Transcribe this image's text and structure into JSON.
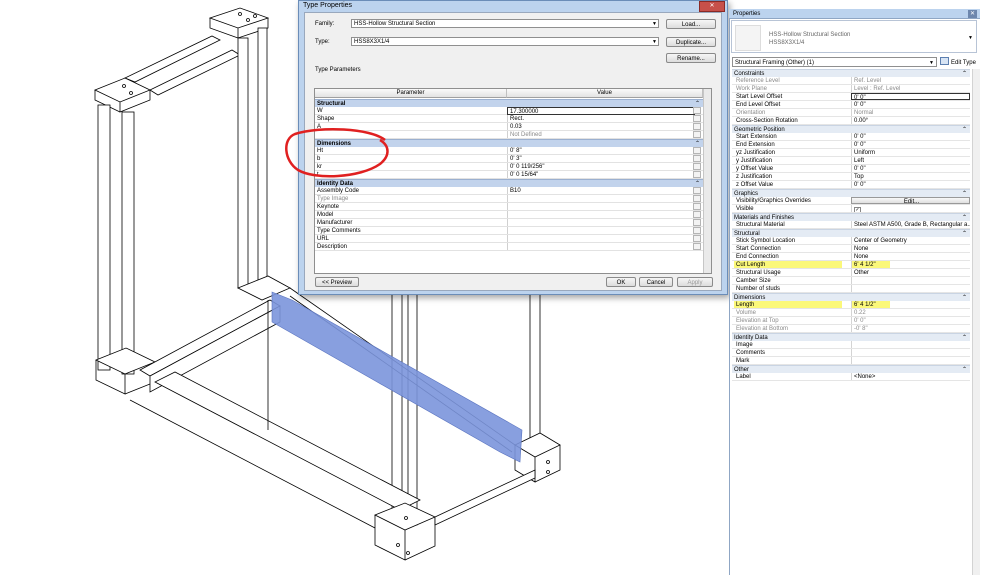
{
  "dialog": {
    "title": "Type Properties",
    "family_label": "Family:",
    "family_value": "HSS-Hollow Structural Section",
    "type_label": "Type:",
    "type_value": "HSS8X3X1/4",
    "load_btn": "Load...",
    "duplicate_btn": "Duplicate...",
    "rename_btn": "Rename...",
    "type_params_label": "Type Parameters",
    "col_parameter": "Parameter",
    "col_value": "Value",
    "groups": [
      {
        "name": "Structural",
        "rows": [
          {
            "p": "W",
            "v": "17.300000"
          },
          {
            "p": "Shape",
            "v": "Rect."
          },
          {
            "p": "A",
            "v": "0.03"
          },
          {
            "p": "",
            "v": "Not Defined"
          }
        ]
      },
      {
        "name": "Dimensions",
        "rows": [
          {
            "p": "Ht",
            "v": "0'  8\""
          },
          {
            "p": "b",
            "v": "0'  3\""
          },
          {
            "p": "kr",
            "v": "0'  0 119/256\""
          },
          {
            "p": "t",
            "v": "0'  0 15/64\""
          }
        ]
      },
      {
        "name": "Identity Data",
        "rows": [
          {
            "p": "Assembly Code",
            "v": "B10"
          },
          {
            "p": "Type Image",
            "v": ""
          },
          {
            "p": "Keynote",
            "v": ""
          },
          {
            "p": "Model",
            "v": ""
          },
          {
            "p": "Manufacturer",
            "v": ""
          },
          {
            "p": "Type Comments",
            "v": ""
          },
          {
            "p": "URL",
            "v": ""
          },
          {
            "p": "Description",
            "v": ""
          }
        ]
      }
    ],
    "preview_btn": "<< Preview",
    "ok_btn": "OK",
    "cancel_btn": "Cancel",
    "apply_btn": "Apply"
  },
  "properties": {
    "title": "Properties",
    "type_line1": "HSS-Hollow Structural Section",
    "type_line2": "HSS8X3X1/4",
    "instance_filter": "Structural Framing (Other) (1)",
    "edit_type": "Edit Type",
    "groups": [
      {
        "name": "Constraints",
        "rows": [
          {
            "p": "Reference Level",
            "v": "Ref. Level",
            "gray": true
          },
          {
            "p": "Work Plane",
            "v": "Level : Ref. Level",
            "gray": true
          },
          {
            "p": "Start Level Offset",
            "v": "0'  0\""
          },
          {
            "p": "End Level Offset",
            "v": "0'  0\""
          },
          {
            "p": "Orientation",
            "v": "Normal",
            "gray": true
          },
          {
            "p": "Cross-Section Rotation",
            "v": "0.00°"
          }
        ]
      },
      {
        "name": "Geometric Position",
        "rows": [
          {
            "p": "Start Extension",
            "v": "0'  0\""
          },
          {
            "p": "End Extension",
            "v": "0'  0\""
          },
          {
            "p": "yz Justification",
            "v": "Uniform"
          },
          {
            "p": "y Justification",
            "v": "Left"
          },
          {
            "p": "y Offset Value",
            "v": "0'  0\""
          },
          {
            "p": "z Justification",
            "v": "Top"
          },
          {
            "p": "z Offset Value",
            "v": "0'  0\""
          }
        ]
      },
      {
        "name": "Graphics",
        "rows": [
          {
            "p": "Visibility/Graphics Overrides",
            "v": "Edit..."
          },
          {
            "p": "Visible",
            "v": "✓"
          }
        ]
      },
      {
        "name": "Materials and Finishes",
        "rows": [
          {
            "p": "Structural Material",
            "v": "Steel ASTM A500, Grade B, Rectangular a..."
          }
        ]
      },
      {
        "name": "Structural",
        "rows": [
          {
            "p": "Stick Symbol Location",
            "v": "Center of Geometry"
          },
          {
            "p": "Start Connection",
            "v": "None"
          },
          {
            "p": "End Connection",
            "v": "None"
          },
          {
            "p": "Cut Length",
            "v": "6'  4 1/2\"",
            "hl": true
          },
          {
            "p": "Structural Usage",
            "v": "Other"
          },
          {
            "p": "Camber Size",
            "v": ""
          },
          {
            "p": "Number of studs",
            "v": ""
          }
        ]
      },
      {
        "name": "Dimensions",
        "rows": [
          {
            "p": "Length",
            "v": "6'  4 1/2\"",
            "hl": true
          },
          {
            "p": "Volume",
            "v": "0.22",
            "gray": true
          },
          {
            "p": "Elevation at Top",
            "v": "0'  0\"",
            "gray": true
          },
          {
            "p": "Elevation at Bottom",
            "v": "-0'  8\"",
            "gray": true
          }
        ]
      },
      {
        "name": "Identity Data",
        "rows": [
          {
            "p": "Image",
            "v": ""
          },
          {
            "p": "Comments",
            "v": ""
          },
          {
            "p": "Mark",
            "v": ""
          }
        ]
      },
      {
        "name": "Other",
        "rows": [
          {
            "p": "Label",
            "v": "<None>"
          }
        ]
      }
    ]
  }
}
